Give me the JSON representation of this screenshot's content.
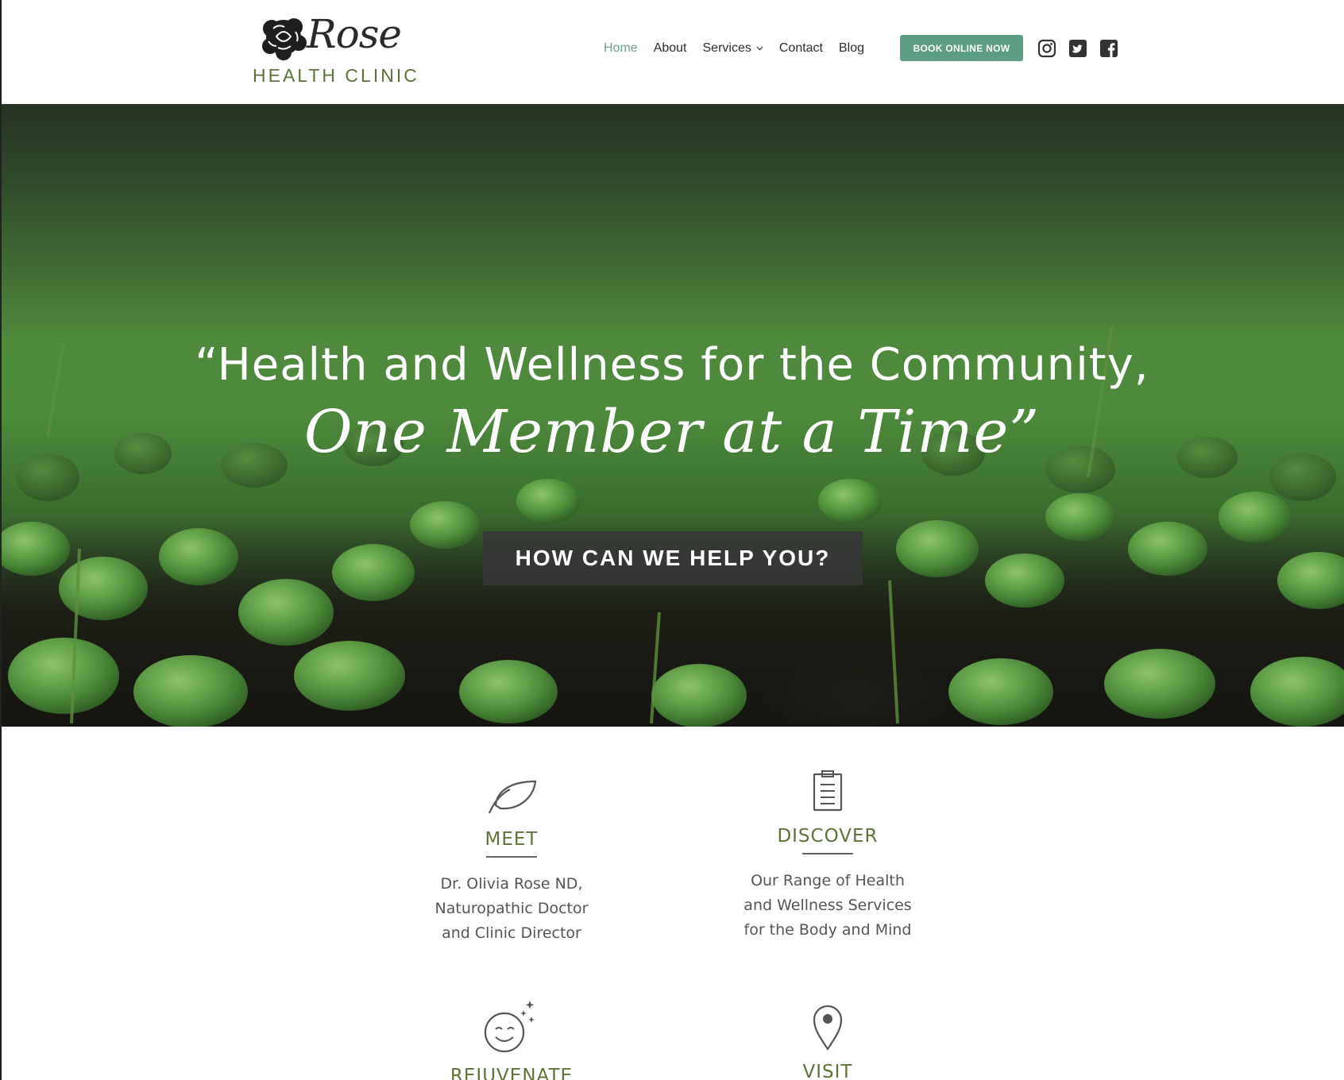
{
  "header": {
    "logo": {
      "script_word": "Rose",
      "subtitle": "HEALTH CLINIC"
    },
    "nav": [
      {
        "label": "Home",
        "active": true
      },
      {
        "label": "About",
        "active": false
      },
      {
        "label": "Services",
        "active": false,
        "has_dropdown": true
      },
      {
        "label": "Contact",
        "active": false
      },
      {
        "label": "Blog",
        "active": false
      }
    ],
    "cta_label": "BOOK ONLINE NOW",
    "social": [
      "instagram-icon",
      "twitter-icon",
      "facebook-icon"
    ]
  },
  "hero": {
    "quote_line1": "“Health and Wellness for the Community,",
    "quote_line2": "One Member at a Time”",
    "button_label": "HOW CAN WE HELP YOU?"
  },
  "features": {
    "meet": {
      "icon": "leaf-icon",
      "title": "MEET",
      "desc": "Dr. Olivia Rose ND,\nNaturopathic Doctor\nand Clinic Director"
    },
    "discover": {
      "icon": "clipboard-icon",
      "title": "DISCOVER",
      "desc": "Our Range of Health\nand Wellness Services\nfor the Body and Mind"
    },
    "rejuvenate": {
      "icon": "smile-sparkle-icon",
      "title": "REJUVENATE"
    },
    "visit": {
      "icon": "map-pin-icon",
      "title": "VISIT"
    }
  },
  "colors": {
    "brand_green": "#5c7337",
    "accent_teal": "#5b9e82",
    "nav_active": "#6aa287",
    "help_button_bg": "#373737"
  }
}
